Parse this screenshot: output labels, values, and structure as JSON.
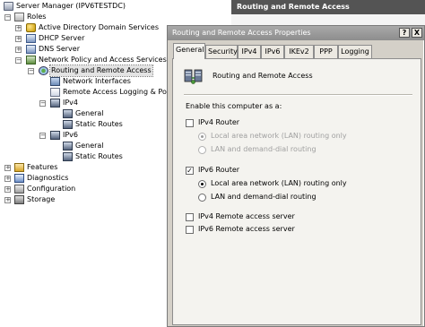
{
  "tree": {
    "items": [
      {
        "label": "Server Manager (IPV6TESTDC)",
        "icon": "server-manager-icon",
        "expander": ""
      },
      {
        "label": "Roles",
        "icon": "roles-icon",
        "expander": "−"
      },
      {
        "label": "Active Directory Domain Services",
        "icon": "ad-ds-icon",
        "expander": "+"
      },
      {
        "label": "DHCP Server",
        "icon": "dhcp-icon",
        "expander": "+"
      },
      {
        "label": "DNS Server",
        "icon": "dns-icon",
        "expander": "+"
      },
      {
        "label": "Network Policy and Access Services",
        "icon": "npas-icon",
        "expander": "−"
      },
      {
        "label": "Routing and Remote Access",
        "icon": "rras-icon",
        "expander": "−",
        "selected": true
      },
      {
        "label": "Network Interfaces",
        "icon": "network-interfaces-icon",
        "expander": ""
      },
      {
        "label": "Remote Access Logging & Policies",
        "icon": "logging-icon",
        "expander": ""
      },
      {
        "label": "IPv4",
        "icon": "ipv4-icon",
        "expander": "−"
      },
      {
        "label": "General",
        "icon": "general-icon",
        "expander": ""
      },
      {
        "label": "Static Routes",
        "icon": "static-routes-icon",
        "expander": ""
      },
      {
        "label": "IPv6",
        "icon": "ipv6-icon",
        "expander": "−"
      },
      {
        "label": "General",
        "icon": "general-icon",
        "expander": ""
      },
      {
        "label": "Static Routes",
        "icon": "static-routes-icon",
        "expander": ""
      },
      {
        "label": "Features",
        "icon": "features-icon",
        "expander": "+"
      },
      {
        "label": "Diagnostics",
        "icon": "diagnostics-icon",
        "expander": "+"
      },
      {
        "label": "Configuration",
        "icon": "configuration-icon",
        "expander": "+"
      },
      {
        "label": "Storage",
        "icon": "storage-icon",
        "expander": "+"
      }
    ]
  },
  "right_panel": {
    "header": "Routing and Remote Access"
  },
  "dialog": {
    "title": "Routing and Remote Access Properties",
    "help_button": "?",
    "close_button": "X",
    "tabs": [
      "General",
      "Security",
      "IPv4",
      "IPv6",
      "IKEv2",
      "PPP",
      "Logging"
    ],
    "active_tab": "General",
    "header_label": "Routing and Remote Access",
    "enable_label": "Enable this computer as a:",
    "ipv4_router": {
      "label": "IPv4 Router",
      "checked": false
    },
    "ipv4_lan": {
      "label": "Local area network (LAN) routing only",
      "selected": true,
      "disabled": true
    },
    "ipv4_lan_dd": {
      "label": "LAN and demand-dial routing",
      "selected": false,
      "disabled": true
    },
    "ipv6_router": {
      "label": "IPv6 Router",
      "checked": true
    },
    "ipv6_lan": {
      "label": "Local area network (LAN) routing only",
      "selected": true,
      "disabled": false
    },
    "ipv6_lan_dd": {
      "label": "LAN and demand-dial routing",
      "selected": false,
      "disabled": false
    },
    "ipv4_ras": {
      "label": "IPv4 Remote access server",
      "checked": false
    },
    "ipv6_ras": {
      "label": "IPv6 Remote access server",
      "checked": false
    }
  }
}
